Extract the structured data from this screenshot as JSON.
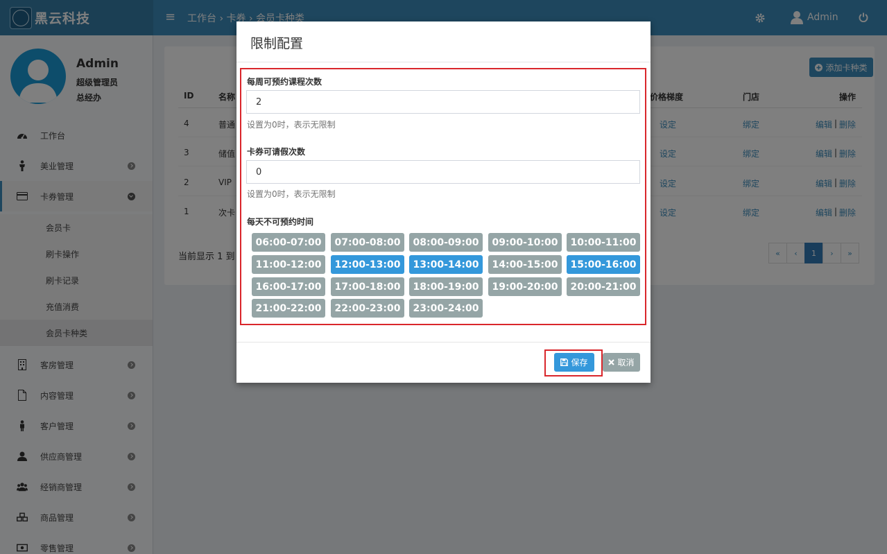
{
  "brand": {
    "name": "黑云科技"
  },
  "header": {
    "breadcrumb": [
      "工作台",
      "卡券",
      "会员卡种类"
    ],
    "separator": "›",
    "user_name": "Admin"
  },
  "profile": {
    "name": "Admin",
    "role": "超级管理员",
    "dept": "总经办"
  },
  "sidebar": {
    "items": [
      {
        "label": "工作台",
        "icon": "dashboard-icon"
      },
      {
        "label": "美业管理",
        "icon": "person-icon"
      },
      {
        "label": "卡券管理",
        "icon": "card-icon"
      },
      {
        "label": "客房管理",
        "icon": "building-icon"
      },
      {
        "label": "内容管理",
        "icon": "file-icon"
      },
      {
        "label": "客户管理",
        "icon": "person-icon"
      },
      {
        "label": "供应商管理",
        "icon": "user-icon"
      },
      {
        "label": "经销商管理",
        "icon": "users-icon"
      },
      {
        "label": "商品管理",
        "icon": "cubes-icon"
      },
      {
        "label": "零售管理",
        "icon": "money-icon"
      }
    ],
    "sub_items": [
      "会员卡",
      "刷卡操作",
      "刷卡记录",
      "充值消费",
      "会员卡种类"
    ]
  },
  "main": {
    "add_button": "添加卡种类",
    "columns": [
      "ID",
      "名称",
      "价格梯度",
      "门店",
      "操作"
    ],
    "rows": [
      {
        "id": "4",
        "name": "普通",
        "price": "设定",
        "store": "绑定",
        "edit": "编辑",
        "sep": "|",
        "del": "删除"
      },
      {
        "id": "3",
        "name": "储值",
        "price": "设定",
        "store": "绑定",
        "edit": "编辑",
        "sep": "|",
        "del": "删除"
      },
      {
        "id": "2",
        "name": "VIP",
        "price": "设定",
        "store": "绑定",
        "edit": "编辑",
        "sep": "|",
        "del": "删除"
      },
      {
        "id": "1",
        "name": "次卡",
        "price": "设定",
        "store": "绑定",
        "edit": "编辑",
        "sep": "|",
        "del": "删除"
      }
    ],
    "footer_text": "当前显示 1 到",
    "pager": [
      "«",
      "‹",
      "1",
      "›",
      "»"
    ]
  },
  "modal": {
    "title": "限制配置",
    "weekly_label": "每周可预约课程次数",
    "weekly_value": "2",
    "weekly_help": "设置为0时，表示无限制",
    "leave_label": "卡券可请假次数",
    "leave_value": "0",
    "leave_help": "设置为0时，表示无限制",
    "slots_label": "每天不可预约时间",
    "slots": [
      {
        "label": "06:00-07:00",
        "selected": false
      },
      {
        "label": "07:00-08:00",
        "selected": false
      },
      {
        "label": "08:00-09:00",
        "selected": false
      },
      {
        "label": "09:00-10:00",
        "selected": false
      },
      {
        "label": "10:00-11:00",
        "selected": false
      },
      {
        "label": "11:00-12:00",
        "selected": false
      },
      {
        "label": "12:00-13:00",
        "selected": true
      },
      {
        "label": "13:00-14:00",
        "selected": true
      },
      {
        "label": "14:00-15:00",
        "selected": false
      },
      {
        "label": "15:00-16:00",
        "selected": true
      },
      {
        "label": "16:00-17:00",
        "selected": false
      },
      {
        "label": "17:00-18:00",
        "selected": false
      },
      {
        "label": "18:00-19:00",
        "selected": false
      },
      {
        "label": "19:00-20:00",
        "selected": false
      },
      {
        "label": "20:00-21:00",
        "selected": false
      },
      {
        "label": "21:00-22:00",
        "selected": false
      },
      {
        "label": "22:00-23:00",
        "selected": false
      },
      {
        "label": "23:00-24:00",
        "selected": false
      }
    ],
    "save_label": "保存",
    "cancel_label": "取消"
  },
  "colors": {
    "header": "#3c8dbc",
    "slot_selected": "#3498db",
    "slot_default": "#95a5a6",
    "highlight_frame": "#d9262b"
  }
}
